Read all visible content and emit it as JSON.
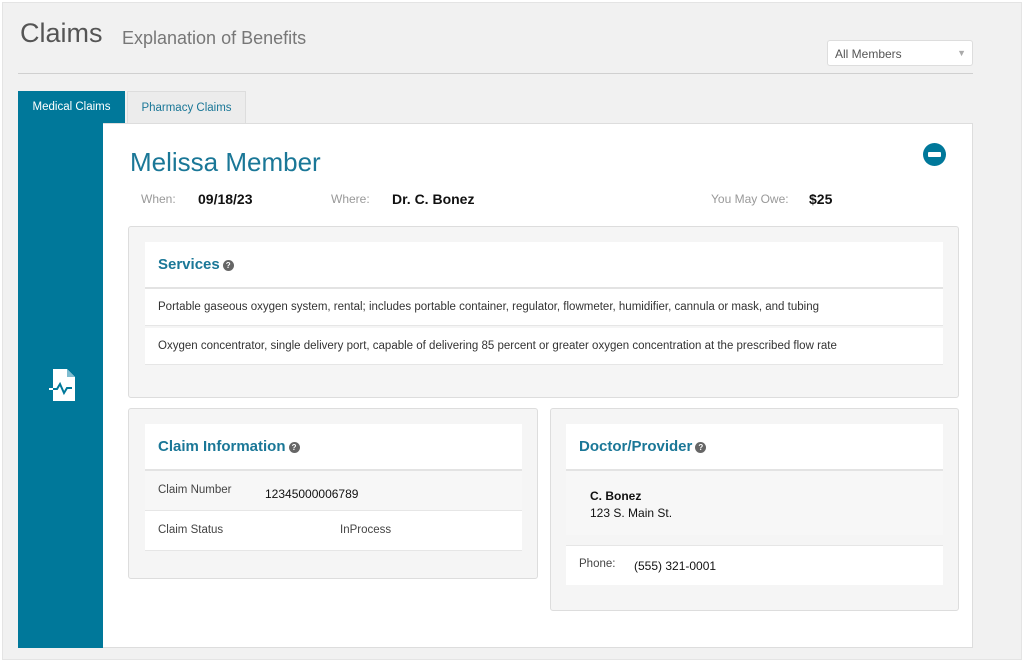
{
  "header": {
    "title": "Claims",
    "subtitle": "Explanation of Benefits"
  },
  "member_filter": {
    "selected": "All Members"
  },
  "tabs": [
    {
      "label": "Medical Claims",
      "active": true
    },
    {
      "label": "Pharmacy Claims",
      "active": false
    }
  ],
  "claim": {
    "member_name": "Melissa Member",
    "when_label": "When:",
    "when": "09/18/23",
    "where_label": "Where:",
    "where": "Dr. C. Bonez",
    "owe_label": "You May Owe:",
    "owe": "$25",
    "services": {
      "title": "Services",
      "items": [
        "Portable gaseous oxygen system, rental; includes portable container, regulator, flowmeter, humidifier, cannula or mask, and tubing",
        "Oxygen concentrator, single delivery port, capable of delivering 85 percent or greater oxygen concentration at the prescribed flow rate"
      ]
    },
    "info": {
      "title": "Claim Information",
      "number_label": "Claim Number",
      "number": "12345000006789",
      "status_label": "Claim Status",
      "status": "InProcess"
    },
    "provider": {
      "title": "Doctor/Provider",
      "name": "C. Bonez",
      "address": "123 S. Main St.",
      "phone_label": "Phone:",
      "phone": "(555) 321-0001"
    }
  },
  "colors": {
    "accent": "#00789a",
    "link": "#1a7797"
  }
}
